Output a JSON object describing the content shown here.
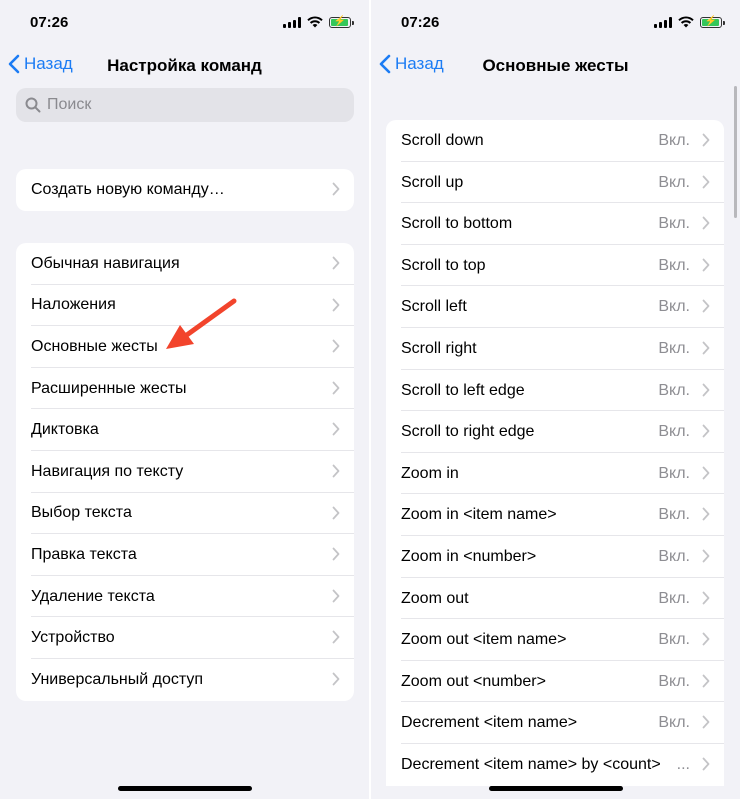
{
  "left": {
    "status": {
      "time": "07:26"
    },
    "nav": {
      "back_label": "Назад",
      "title": "Настройка команд"
    },
    "search": {
      "placeholder": "Поиск"
    },
    "create_group": [
      {
        "label": "Создать новую команду…"
      }
    ],
    "categories": [
      {
        "label": "Обычная навигация"
      },
      {
        "label": "Наложения"
      },
      {
        "label": "Основные жесты"
      },
      {
        "label": "Расширенные жесты"
      },
      {
        "label": "Диктовка"
      },
      {
        "label": "Навигация по тексту"
      },
      {
        "label": "Выбор текста"
      },
      {
        "label": "Правка текста"
      },
      {
        "label": "Удаление текста"
      },
      {
        "label": "Устройство"
      },
      {
        "label": "Универсальный доступ"
      }
    ]
  },
  "right": {
    "status": {
      "time": "07:26"
    },
    "nav": {
      "back_label": "Назад",
      "title": "Основные жесты"
    },
    "commands": [
      {
        "label": "Scroll down",
        "value": "Вкл."
      },
      {
        "label": "Scroll up",
        "value": "Вкл."
      },
      {
        "label": "Scroll to bottom",
        "value": "Вкл."
      },
      {
        "label": "Scroll to top",
        "value": "Вкл."
      },
      {
        "label": "Scroll left",
        "value": "Вкл."
      },
      {
        "label": "Scroll right",
        "value": "Вкл."
      },
      {
        "label": "Scroll to left edge",
        "value": "Вкл."
      },
      {
        "label": "Scroll to right edge",
        "value": "Вкл."
      },
      {
        "label": "Zoom in",
        "value": "Вкл."
      },
      {
        "label": "Zoom in <item name>",
        "value": "Вкл."
      },
      {
        "label": "Zoom in <number>",
        "value": "Вкл."
      },
      {
        "label": "Zoom out",
        "value": "Вкл."
      },
      {
        "label": "Zoom out <item name>",
        "value": "Вкл."
      },
      {
        "label": "Zoom out <number>",
        "value": "Вкл."
      },
      {
        "label": "Decrement <item name>",
        "value": "Вкл."
      },
      {
        "label": "Decrement <item name> by <count>",
        "value": "..."
      }
    ]
  },
  "colors": {
    "accent": "#1c7cf4",
    "arrow": "#f2442c",
    "battery": "#34c759"
  },
  "icons": [
    "signal-icon",
    "wifi-icon",
    "battery-icon",
    "back-chevron-icon",
    "search-icon",
    "chevron-right-icon",
    "annotation-arrow-icon"
  ]
}
